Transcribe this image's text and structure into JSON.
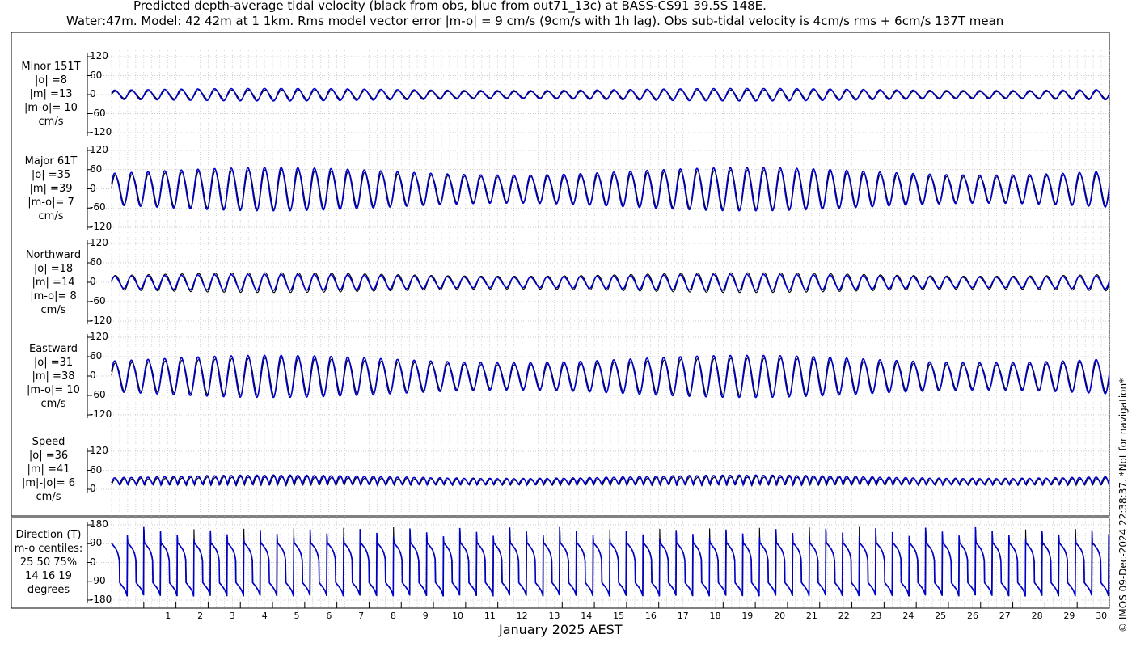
{
  "title_line1": "Predicted depth-average tidal velocity (black from obs, blue from out71_13c) at BASS-CS91 39.5S 148E.",
  "title_line2": "Water:47m. Model: 42 42m at 1 1km. Rms model vector error |m-o| = 9 cm/s (9cm/s with 1h lag). Obs sub-tidal velocity is 4cm/s rms + 6cm/s 137T mean",
  "copyright": "© IMOS 09-Dec-2024 22:38:37. *Not for navigation*",
  "colors": {
    "observed": "#000000",
    "model": "#0000cc",
    "grid": "#bbbbbb"
  },
  "chart_data": {
    "type": "line",
    "xlabel": "January 2025 AEST",
    "x_ticks": [
      "1",
      "2",
      "3",
      "4",
      "5",
      "6",
      "7",
      "8",
      "9",
      "10",
      "11",
      "12",
      "13",
      "14",
      "15",
      "16",
      "17",
      "18",
      "19",
      "20",
      "21",
      "22",
      "23",
      "24",
      "25",
      "26",
      "27",
      "28",
      "29",
      "30"
    ],
    "xlim": [
      0.0,
      31.0
    ],
    "series": [
      {
        "name": "obs",
        "color": "#000000"
      },
      {
        "name": "out71_13c",
        "color": "#0000cc"
      }
    ],
    "panels": [
      {
        "id": "minor",
        "label_lines": [
          "Minor 151T",
          "|o| =8",
          "|m| =13",
          "|m-o|= 10",
          "cm/s"
        ],
        "ylim": [
          -120,
          120
        ],
        "yticks": [
          "120",
          "60",
          "0",
          "-60",
          "-120"
        ],
        "tick_values": [
          120,
          60,
          0,
          -60,
          -120
        ],
        "obs_amplitude": 12,
        "model_amplitude": 16
      },
      {
        "id": "major",
        "label_lines": [
          "Major 61T",
          "|o| =35",
          "|m| =39",
          "|m-o|= 7",
          "cm/s"
        ],
        "ylim": [
          -120,
          120
        ],
        "yticks": [
          "120",
          "60",
          "0",
          "-60",
          "-120"
        ],
        "tick_values": [
          120,
          60,
          0,
          -60,
          -120
        ],
        "obs_amplitude": 50,
        "model_amplitude": 55
      },
      {
        "id": "northward",
        "label_lines": [
          "Northward",
          "|o| =18",
          "|m| =14",
          "|m-o|= 8",
          "cm/s"
        ],
        "ylim": [
          -120,
          120
        ],
        "yticks": [
          "120",
          "60",
          "0",
          "-60",
          "-120"
        ],
        "tick_values": [
          120,
          60,
          0,
          -60,
          -120
        ],
        "obs_amplitude": 25,
        "model_amplitude": 20
      },
      {
        "id": "eastward",
        "label_lines": [
          "Eastward",
          "|o| =31",
          "|m| =38",
          "|m-o|= 10",
          "cm/s"
        ],
        "ylim": [
          -120,
          120
        ],
        "yticks": [
          "120",
          "60",
          "0",
          "-60",
          "-120"
        ],
        "tick_values": [
          120,
          60,
          0,
          -60,
          -120
        ],
        "obs_amplitude": 47,
        "model_amplitude": 53
      },
      {
        "id": "speed",
        "label_lines": [
          "Speed",
          "|o| =36",
          "|m| =41",
          "|m|-|o|= 6",
          "cm/s"
        ],
        "ylim": [
          0,
          120
        ],
        "yticks": [
          "120",
          "60",
          "0"
        ],
        "tick_values": [
          120,
          60,
          0
        ],
        "obs_amplitude": 36,
        "model_amplitude": 41
      },
      {
        "id": "direction",
        "label_lines": [
          "Direction (T)",
          "m-o centiles:",
          "25  50  75%",
          "14  16  19",
          "degrees"
        ],
        "ylim": [
          -180,
          180
        ],
        "yticks": [
          "180",
          "90",
          "0",
          "-90",
          "-180"
        ],
        "tick_values": [
          180,
          90,
          0,
          -90,
          -180
        ]
      }
    ]
  }
}
